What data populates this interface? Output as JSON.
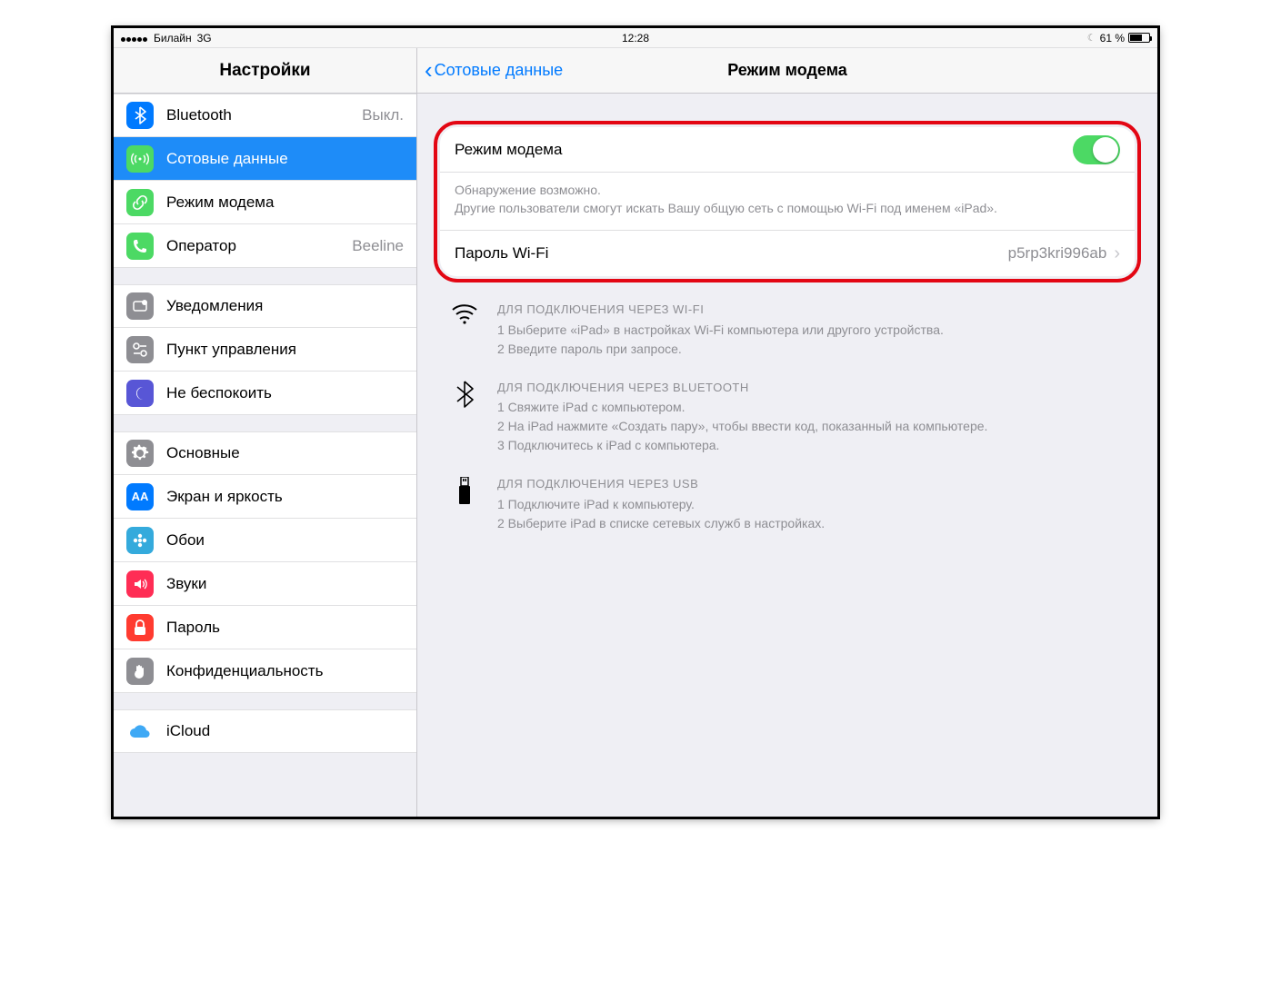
{
  "status": {
    "carrier": "Билайн",
    "network": "3G",
    "time": "12:28",
    "battery": "61 %"
  },
  "sidebar": {
    "title": "Настройки",
    "g1": [
      {
        "label": "Bluetooth",
        "value": "Выкл."
      },
      {
        "label": "Сотовые данные"
      },
      {
        "label": "Режим модема"
      },
      {
        "label": "Оператор",
        "value": "Beeline"
      }
    ],
    "g2": [
      {
        "label": "Уведомления"
      },
      {
        "label": "Пункт управления"
      },
      {
        "label": "Не беспокоить"
      }
    ],
    "g3": [
      {
        "label": "Основные"
      },
      {
        "label": "Экран и яркость"
      },
      {
        "label": "Обои"
      },
      {
        "label": "Звуки"
      },
      {
        "label": "Пароль"
      },
      {
        "label": "Конфиденциальность"
      }
    ],
    "g4": [
      {
        "label": "iCloud"
      }
    ]
  },
  "detail": {
    "back": "Сотовые данные",
    "title": "Режим модема",
    "toggle_label": "Режим модема",
    "note_line1": "Обнаружение возможно.",
    "note_line2": "Другие пользователи смогут искать Вашу общую сеть с помощью Wi-Fi под именем «iPad».",
    "pw_label": "Пароль Wi-Fi",
    "pw_value": "p5rp3kri996ab",
    "wifi": {
      "hd": "ДЛЯ ПОДКЛЮЧЕНИЯ ЧЕРЕЗ WI-FI",
      "l1": "1 Выберите «iPad» в настройках Wi-Fi компьютера или другого устройства.",
      "l2": "2 Введите пароль при запросе."
    },
    "bt": {
      "hd": "ДЛЯ ПОДКЛЮЧЕНИЯ ЧЕРЕЗ BLUETOOTH",
      "l1": "1 Свяжите iPad с компьютером.",
      "l2": "2 На iPad нажмите «Создать пару», чтобы ввести код, показанный на компьютере.",
      "l3": "3 Подключитесь к iPad с компьютера."
    },
    "usb": {
      "hd": "ДЛЯ ПОДКЛЮЧЕНИЯ ЧЕРЕЗ USB",
      "l1": "1 Подключите iPad к компьютеру.",
      "l2": "2 Выберите iPad в списке сетевых служб в настройках."
    }
  }
}
